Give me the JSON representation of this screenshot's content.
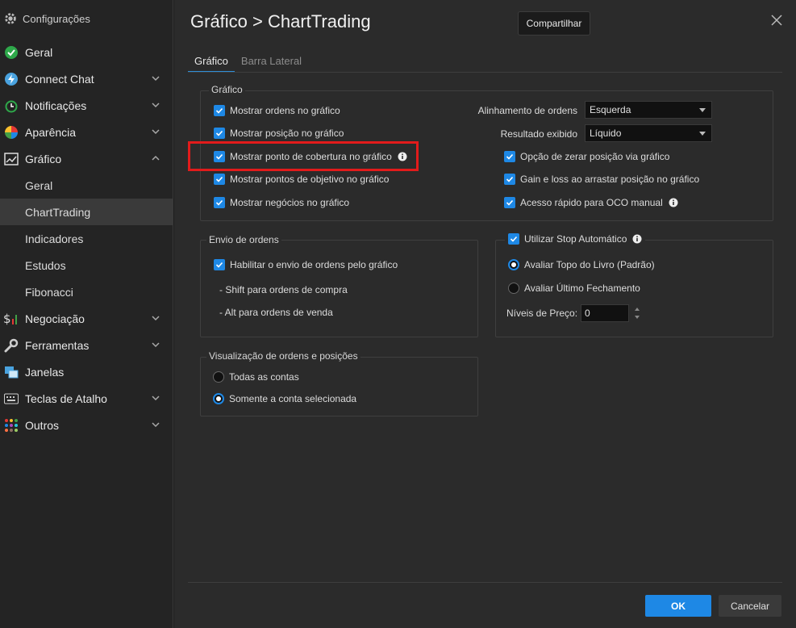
{
  "sidebar": {
    "header": "Configurações",
    "items": [
      {
        "label": "Geral"
      },
      {
        "label": "Connect Chat"
      },
      {
        "label": "Notificações"
      },
      {
        "label": "Aparência"
      },
      {
        "label": "Gráfico"
      },
      {
        "label": "Negociação"
      },
      {
        "label": "Ferramentas"
      },
      {
        "label": "Janelas"
      },
      {
        "label": "Teclas de Atalho"
      },
      {
        "label": "Outros"
      }
    ],
    "sub_items": [
      {
        "label": "Geral"
      },
      {
        "label": "ChartTrading"
      },
      {
        "label": "Indicadores"
      },
      {
        "label": "Estudos"
      },
      {
        "label": "Fibonacci"
      }
    ]
  },
  "header": {
    "title": "Gráfico > ChartTrading",
    "share_tooltip": "Compartilhar"
  },
  "tabs": [
    {
      "label": "Gráfico",
      "active": true
    },
    {
      "label": "Barra Lateral",
      "active": false
    }
  ],
  "grafico_group": {
    "title": "Gráfico",
    "left_options": [
      {
        "label": "Mostrar ordens no gráfico",
        "checked": true
      },
      {
        "label": "Mostrar posição no gráfico",
        "checked": true
      },
      {
        "label": "Mostrar ponto de cobertura no gráfico",
        "checked": true
      },
      {
        "label": "Mostrar pontos de objetivo no gráfico",
        "checked": true
      },
      {
        "label": "Mostrar negócios no gráfico",
        "checked": true
      }
    ],
    "alinhamento_label": "Alinhamento de ordens",
    "alinhamento_value": "Esquerda",
    "resultado_label": "Resultado exibido",
    "resultado_value": "Líquido",
    "right_options": [
      {
        "label": "Opção de zerar posição via gráfico",
        "checked": true
      },
      {
        "label": "Gain e loss ao arrastar posição no gráfico",
        "checked": true
      },
      {
        "label": "Acesso rápido para OCO manual",
        "checked": true
      }
    ]
  },
  "envio_group": {
    "title": "Envio de ordens",
    "option": "Habilitar o envio de ordens pelo gráfico",
    "line1": "- Shift para ordens de compra",
    "line2": "- Alt para ordens de venda"
  },
  "stop_group": {
    "title": "Utilizar Stop Automático",
    "radio1": "Avaliar Topo do Livro (Padrão)",
    "radio2": "Avaliar Último Fechamento",
    "niveis_label": "Níveis de Preço:",
    "niveis_value": "0"
  },
  "visual_group": {
    "title": "Visualização de ordens e posições",
    "radio1": "Todas as contas",
    "radio2": "Somente a conta selecionada"
  },
  "footer": {
    "ok": "OK",
    "cancel": "Cancelar"
  },
  "colors": {
    "accent": "#1e88e5",
    "highlight": "#e21b1b"
  }
}
